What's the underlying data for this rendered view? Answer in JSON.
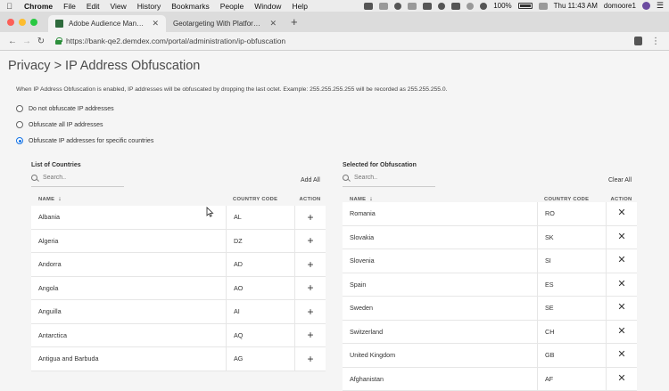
{
  "menubar": {
    "app": "Chrome",
    "items": [
      "File",
      "Edit",
      "View",
      "History",
      "Bookmarks",
      "People",
      "Window",
      "Help"
    ],
    "battery": "100%",
    "clock": "Thu 11:43 AM",
    "user": "domoore1"
  },
  "tabs": [
    {
      "title": "Adobe Audience Manager | Ac",
      "active": true
    },
    {
      "title": "Geotargeting With Platform-le",
      "active": false
    }
  ],
  "address": {
    "url": "https://bank-qe2.demdex.com/portal/administration/ip-obfuscation"
  },
  "page": {
    "title": "Privacy > IP Address Obfuscation",
    "description": "When IP Address Obfuscation is enabled, IP addresses will be obfuscated by dropping the last octet. Example: 255.255.255.255 will be recorded as 255.255.255.0.",
    "options": [
      {
        "label": "Do not obfuscate IP addresses",
        "checked": false
      },
      {
        "label": "Obfuscate all IP addresses",
        "checked": false
      },
      {
        "label": "Obfuscate IP addresses for specific countries",
        "checked": true
      }
    ]
  },
  "list_panel": {
    "title": "List of Countries",
    "search_placeholder": "Search..",
    "action_label": "Add All",
    "columns": {
      "name": "NAME",
      "code": "COUNTRY CODE",
      "action": "ACTION"
    },
    "rows": [
      {
        "name": "Albania",
        "code": "AL"
      },
      {
        "name": "Algeria",
        "code": "DZ"
      },
      {
        "name": "Andorra",
        "code": "AD"
      },
      {
        "name": "Angola",
        "code": "AO"
      },
      {
        "name": "Anguilla",
        "code": "AI"
      },
      {
        "name": "Antarctica",
        "code": "AQ"
      },
      {
        "name": "Antigua and Barbuda",
        "code": "AG"
      }
    ]
  },
  "selected_panel": {
    "title": "Selected for Obfuscation",
    "search_placeholder": "Search..",
    "action_label": "Clear All",
    "columns": {
      "name": "NAME",
      "code": "COUNTRY CODE",
      "action": "ACTION"
    },
    "rows": [
      {
        "name": "Romania",
        "code": "RO"
      },
      {
        "name": "Slovakia",
        "code": "SK"
      },
      {
        "name": "Slovenia",
        "code": "SI"
      },
      {
        "name": "Spain",
        "code": "ES"
      },
      {
        "name": "Sweden",
        "code": "SE"
      },
      {
        "name": "Switzerland",
        "code": "CH"
      },
      {
        "name": "United Kingdom",
        "code": "GB"
      },
      {
        "name": "Afghanistan",
        "code": "AF"
      }
    ]
  },
  "icons": {
    "add": "+",
    "remove": "✕",
    "sort": "↓"
  },
  "colors": {
    "accent": "#1473e6",
    "secure": "#2d8f3c"
  }
}
